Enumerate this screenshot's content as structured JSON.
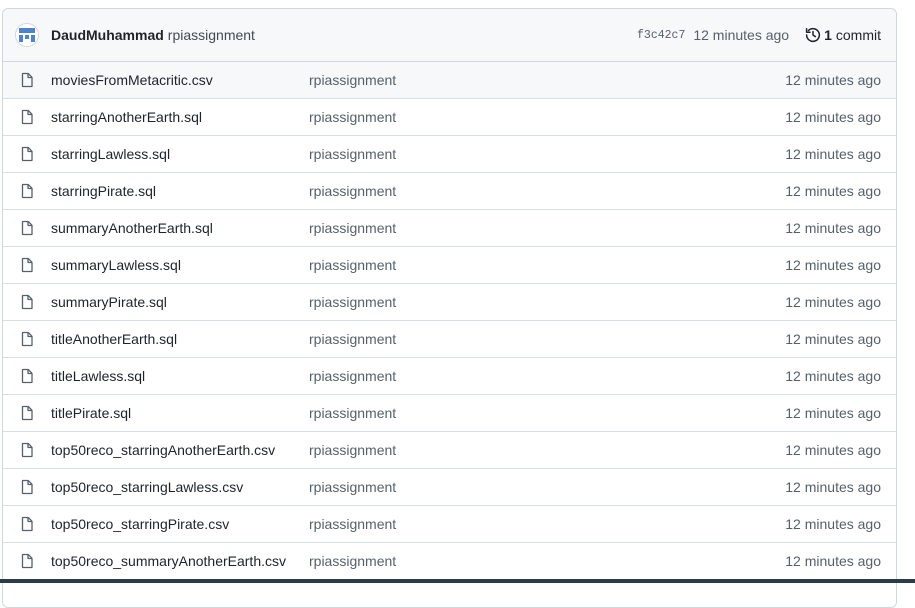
{
  "header": {
    "author": "DaudMuhammad",
    "message": "rpiassignment",
    "sha": "f3c42c7",
    "time": "12 minutes ago",
    "commit_count": "1",
    "commit_label": "commit"
  },
  "files": [
    {
      "name": "moviesFromMetacritic.csv",
      "message": "rpiassignment",
      "time": "12 minutes ago"
    },
    {
      "name": "starringAnotherEarth.sql",
      "message": "rpiassignment",
      "time": "12 minutes ago"
    },
    {
      "name": "starringLawless.sql",
      "message": "rpiassignment",
      "time": "12 minutes ago"
    },
    {
      "name": "starringPirate.sql",
      "message": "rpiassignment",
      "time": "12 minutes ago"
    },
    {
      "name": "summaryAnotherEarth.sql",
      "message": "rpiassignment",
      "time": "12 minutes ago"
    },
    {
      "name": "summaryLawless.sql",
      "message": "rpiassignment",
      "time": "12 minutes ago"
    },
    {
      "name": "summaryPirate.sql",
      "message": "rpiassignment",
      "time": "12 minutes ago"
    },
    {
      "name": "titleAnotherEarth.sql",
      "message": "rpiassignment",
      "time": "12 minutes ago"
    },
    {
      "name": "titleLawless.sql",
      "message": "rpiassignment",
      "time": "12 minutes ago"
    },
    {
      "name": "titlePirate.sql",
      "message": "rpiassignment",
      "time": "12 minutes ago"
    },
    {
      "name": "top50reco_starringAnotherEarth.csv",
      "message": "rpiassignment",
      "time": "12 minutes ago"
    },
    {
      "name": "top50reco_starringLawless.csv",
      "message": "rpiassignment",
      "time": "12 minutes ago"
    },
    {
      "name": "top50reco_starringPirate.csv",
      "message": "rpiassignment",
      "time": "12 minutes ago"
    },
    {
      "name": "top50reco_summaryAnotherEarth.csv",
      "message": "rpiassignment",
      "time": "12 minutes ago"
    }
  ],
  "icons": {
    "file": "file-icon",
    "history": "history-icon",
    "avatar": "avatar"
  },
  "colors": {
    "header_bg": "#f6f8fa",
    "border": "#d0d7de",
    "muted_text": "#57606a",
    "avatar_accent": "#4f83cc"
  }
}
